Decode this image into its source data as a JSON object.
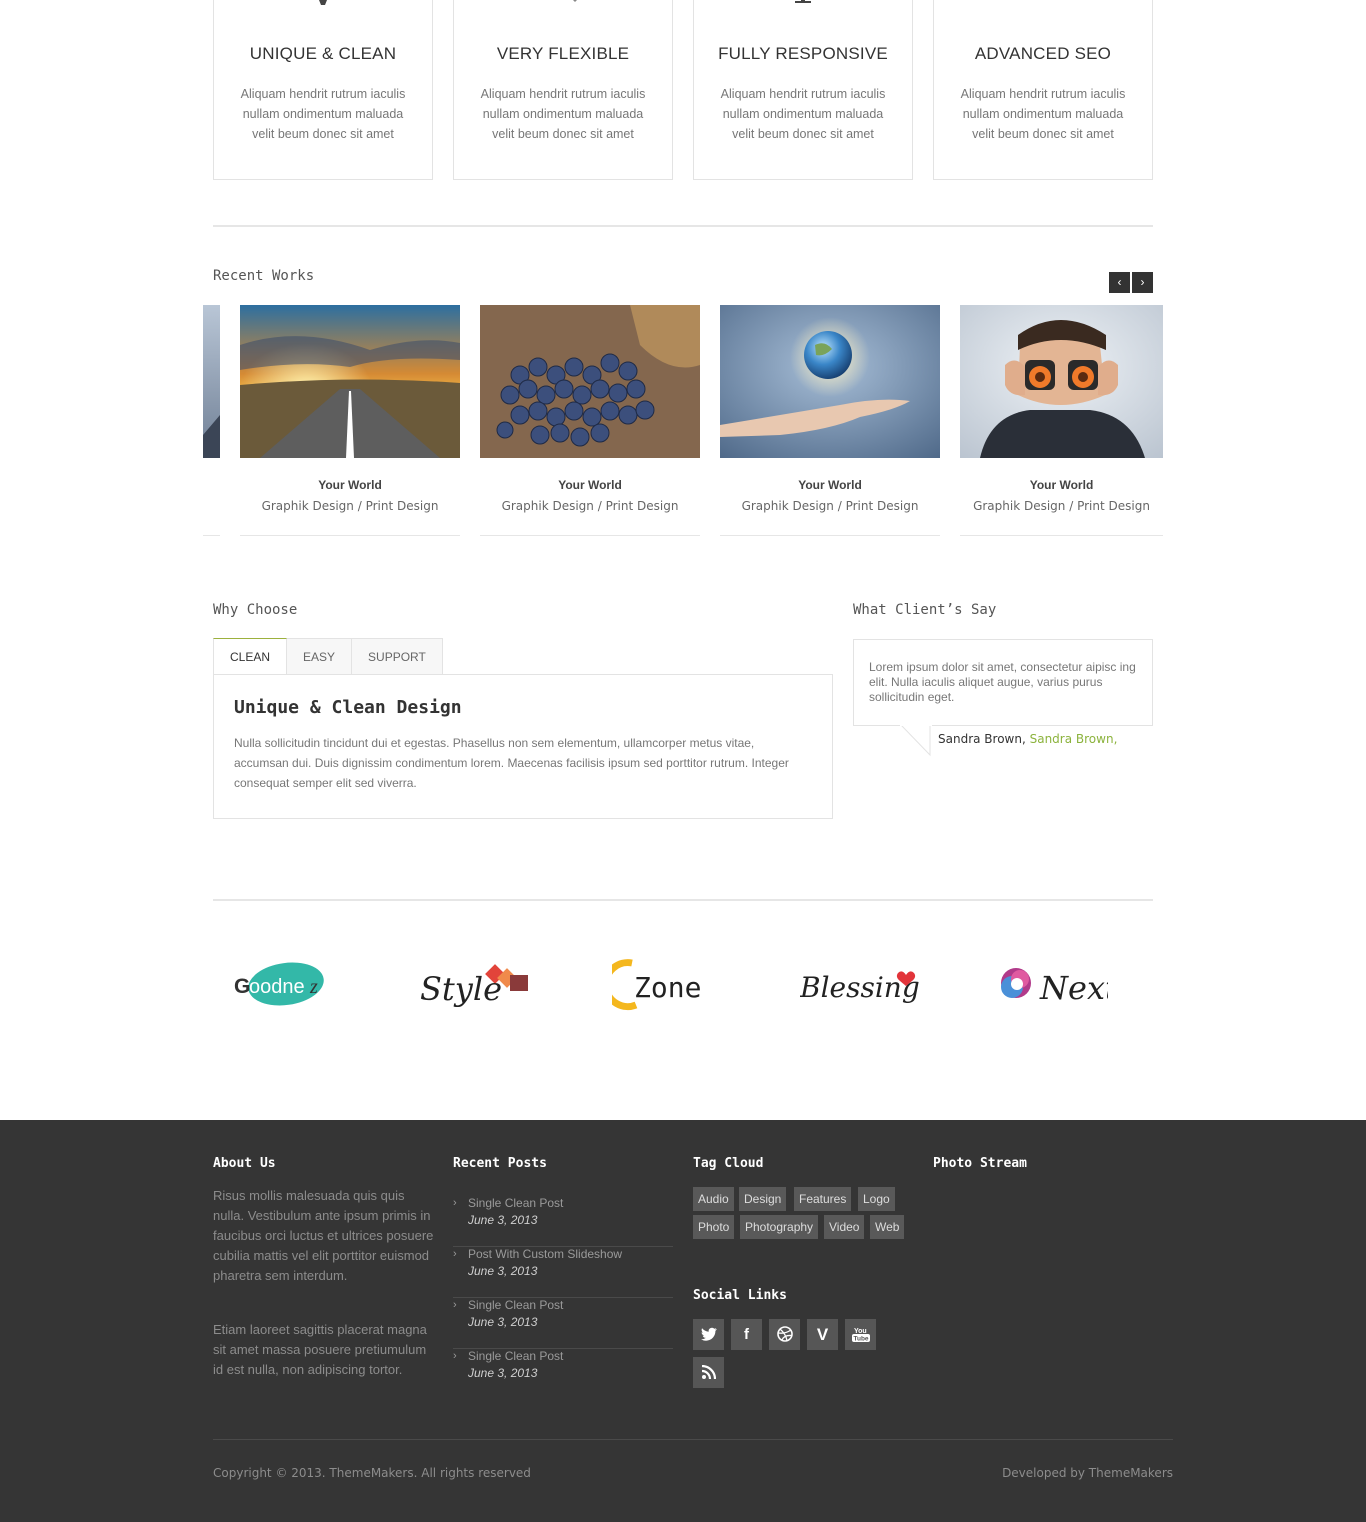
{
  "features": [
    {
      "title": "UNIQUE & CLEAN",
      "text": "Aliquam hendrit rutrum iaculis nullam ondimentum maluada velit beum donec sit amet"
    },
    {
      "title": "VERY FLEXIBLE",
      "text": "Aliquam hendrit rutrum iaculis nullam ondimentum maluada velit beum donec sit amet"
    },
    {
      "title": "FULLY RESPONSIVE",
      "text": "Aliquam hendrit rutrum iaculis nullam ondimentum maluada velit beum donec sit amet"
    },
    {
      "title": "ADVANCED SEO",
      "text": "Aliquam hendrit rutrum iaculis nullam ondimentum maluada velit beum donec sit amet"
    }
  ],
  "recent_works": {
    "title": "Recent Works",
    "prev": "‹",
    "next": "›",
    "items": [
      {
        "title": "Your World",
        "category": "Graphik Design / Print Design"
      },
      {
        "title": "Your World",
        "category": "Graphik Design / Print Design"
      },
      {
        "title": "Your World",
        "category": "Graphik Design / Print Design"
      },
      {
        "title": "Your World",
        "category": "Graphik Design / Print Design"
      }
    ]
  },
  "why_choose": {
    "title": "Why Choose",
    "tabs": [
      "CLEAN",
      "EASY",
      "SUPPORT"
    ],
    "active_tab": "CLEAN",
    "panel_title": "Unique & Clean Design",
    "panel_text": "Nulla sollicitudin tincidunt dui et egestas. Phasellus non sem elementum, ullamcorper metus vitae, accumsan dui. Duis dignissim condimentum lorem. Maecenas facilisis ipsum sed porttitor rutrum. Integer consequat semper elit sed viverra."
  },
  "testimonials": {
    "title": "What Client’s Say",
    "quote": "Lorem ipsum dolor sit amet, consectetur aipisc ing elit. Nulla iaculis aliquet augue, varius purus sollicitudin eget.",
    "author": "Sandra Brown,",
    "author_link": "Sandra Brown,"
  },
  "clients": [
    "Goodnez",
    "Style",
    "Zone",
    "Blessing",
    "Next"
  ],
  "footer": {
    "about_title": "About Us",
    "about_p1": "Risus mollis malesuada quis quis nulla. Vestibulum ante ipsum primis in faucibus orci luctus et ultrices posuere cubilia mattis vel elit porttitor euismod pharetra sem interdum.",
    "about_p2": "Etiam laoreet sagittis placerat magna sit amet massa posuere pretiumulum id est nulla, non adipiscing tortor.",
    "posts_title": "Recent Posts",
    "posts": [
      {
        "title": "Single Clean Post",
        "date": "June 3, 2013"
      },
      {
        "title": "Post With Custom Slideshow",
        "date": "June 3, 2013"
      },
      {
        "title": "Single Clean Post",
        "date": "June 3, 2013"
      },
      {
        "title": "Single Clean Post",
        "date": "June 3, 2013"
      }
    ],
    "tags_title": "Tag Cloud",
    "tags": [
      "Audio",
      "Design",
      "Features",
      "Logo",
      "Photo",
      "Photography",
      "Video",
      "Web"
    ],
    "social_title": "Social Links",
    "social": [
      "twitter-icon",
      "facebook-icon",
      "dribbble-icon",
      "vimeo-icon",
      "youtube-icon",
      "rss-icon"
    ],
    "photo_title": "Photo Stream",
    "copyright": "Copyright © 2013. ThemeMakers. All rights reserved",
    "developed": "Developed by ThemeMakers"
  },
  "colors": {
    "accent": "#8cb33d",
    "footer_bg": "#353535",
    "tab_active_border": "#9cb13d"
  }
}
